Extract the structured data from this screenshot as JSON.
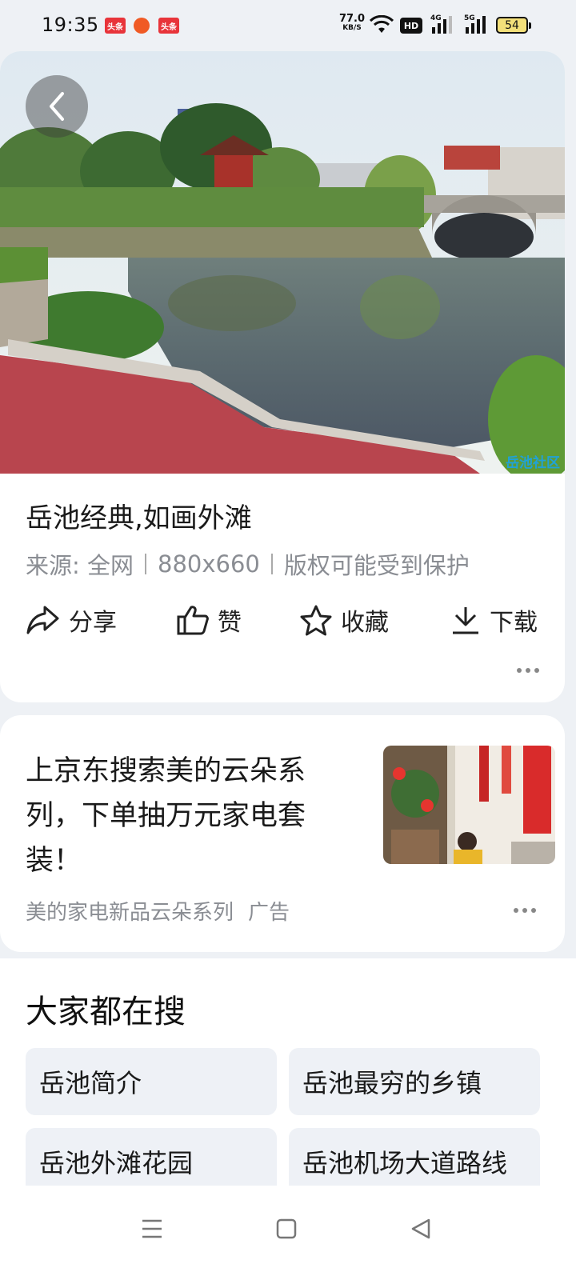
{
  "status_bar": {
    "time": "19:35",
    "notif_1": "头条",
    "notif_2": "头条",
    "net_speed": "77.0",
    "net_unit": "KB/S",
    "hd": "HD",
    "sig_1": "4G",
    "sig_2": "5G",
    "battery": "54"
  },
  "detail": {
    "watermark": "岳池社区",
    "title": "岳池经典,如画外滩",
    "source": "来源: 全网",
    "size": "880x660",
    "copyright": "版权可能受到保护",
    "actions": {
      "share": "分享",
      "like": "赞",
      "favorite": "收藏",
      "download": "下载"
    }
  },
  "ad": {
    "headline": "上京东搜索美的云朵系列，下单抽万元家电套装！",
    "advertiser": "美的家电新品云朵系列",
    "ad_label": "广告"
  },
  "searches": {
    "title": "大家都在搜",
    "items": [
      "岳池简介",
      "岳池最穷的乡镇",
      "岳池外滩花园",
      "岳池机场大道路线"
    ]
  },
  "colors": {
    "page_bg": "#eef1f5",
    "chip_bg": "#eef1f6",
    "secondary_text": "#8a8d93"
  }
}
